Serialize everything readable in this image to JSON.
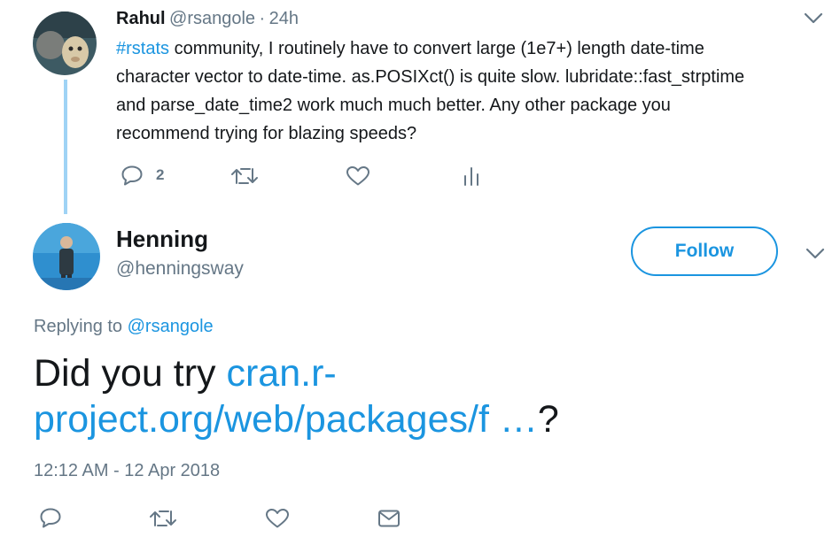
{
  "parent_tweet": {
    "author_name": "Rahul",
    "handle": "@rsangole",
    "separator": "·",
    "time": "24h",
    "hashtag": "#rstats",
    "lines": [
      " community, I routinely have to convert large (1e7+) length date-time",
      "character vector to date-time. as.POSIXct() is quite slow. lubridate::fast_strptime",
      "and parse_date_time2 work much much better. Any other package you",
      "recommend trying for blazing speeds?"
    ],
    "reply_count": "2"
  },
  "main_tweet": {
    "author_name": "Henning",
    "handle": "@henningsway",
    "follow_label": "Follow",
    "replying_prefix": "Replying to",
    "replying_to": "@rsangole",
    "text_prefix": "Did you try ",
    "link_line1": "cran.r-",
    "link_line2": "project.org/web/packages/f …",
    "text_suffix": "?",
    "timestamp": "12:12 AM - 12 Apr 2018"
  },
  "colors": {
    "accent": "#1b95e0",
    "muted": "#657786",
    "thread_line": "#9fd3f5"
  },
  "icons": [
    "reply-icon",
    "retweet-icon",
    "like-icon",
    "analytics-icon",
    "chevron-down-icon",
    "message-icon"
  ]
}
